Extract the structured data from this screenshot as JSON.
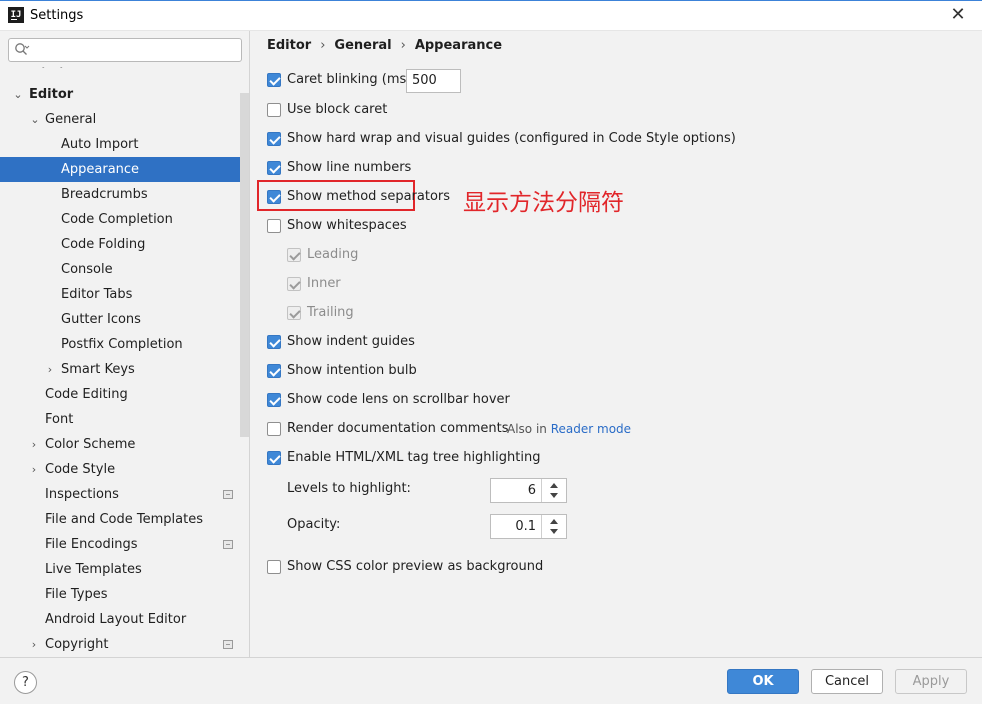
{
  "window": {
    "title": "Settings",
    "app_icon": "IJ"
  },
  "search": {
    "placeholder": "",
    "value": ""
  },
  "sidebar": {
    "items": [
      {
        "label": "Editor",
        "bold": true,
        "arrow": "expanded"
      },
      {
        "label": "General",
        "arrow": "expanded"
      },
      {
        "label": "Auto Import"
      },
      {
        "label": "Appearance",
        "selected": true
      },
      {
        "label": "Breadcrumbs"
      },
      {
        "label": "Code Completion"
      },
      {
        "label": "Code Folding"
      },
      {
        "label": "Console"
      },
      {
        "label": "Editor Tabs"
      },
      {
        "label": "Gutter Icons"
      },
      {
        "label": "Postfix Completion"
      },
      {
        "label": "Smart Keys",
        "arrow": "collapsed"
      },
      {
        "label": "Code Editing"
      },
      {
        "label": "Font"
      },
      {
        "label": "Color Scheme",
        "arrow": "collapsed"
      },
      {
        "label": "Code Style",
        "arrow": "collapsed"
      },
      {
        "label": "Inspections",
        "project_icon": true
      },
      {
        "label": "File and Code Templates"
      },
      {
        "label": "File Encodings",
        "project_icon": true
      },
      {
        "label": "Live Templates"
      },
      {
        "label": "File Types"
      },
      {
        "label": "Android Layout Editor"
      },
      {
        "label": "Copyright",
        "arrow": "collapsed",
        "project_icon": true
      }
    ]
  },
  "breadcrumb": [
    "Editor",
    "General",
    "Appearance"
  ],
  "settings": {
    "caret_blinking": {
      "label": "Caret blinking (ms):",
      "checked": true,
      "value": "500"
    },
    "use_block_caret": {
      "label": "Use block caret",
      "checked": false
    },
    "hard_wrap": {
      "label": "Show hard wrap and visual guides (configured in Code Style options)",
      "checked": true
    },
    "line_numbers": {
      "label": "Show line numbers",
      "checked": true
    },
    "method_separators": {
      "label": "Show method separators",
      "checked": true
    },
    "whitespaces": {
      "label": "Show whitespaces",
      "checked": false
    },
    "leading": {
      "label": "Leading",
      "checked": true,
      "disabled": true
    },
    "inner": {
      "label": "Inner",
      "checked": true,
      "disabled": true
    },
    "trailing": {
      "label": "Trailing",
      "checked": true,
      "disabled": true
    },
    "indent_guides": {
      "label": "Show indent guides",
      "checked": true
    },
    "intention_bulb": {
      "label": "Show intention bulb",
      "checked": true
    },
    "code_lens": {
      "label": "Show code lens on scrollbar hover",
      "checked": true
    },
    "render_docs": {
      "label": "Render documentation comments",
      "checked": false,
      "also_in": "Also in",
      "also_in_link": "Reader mode"
    },
    "tag_tree": {
      "label": "Enable HTML/XML tag tree highlighting",
      "checked": true
    },
    "levels": {
      "label": "Levels to highlight:",
      "value": "6"
    },
    "opacity": {
      "label": "Opacity:",
      "value": "0.1"
    },
    "css_preview": {
      "label": "Show CSS color preview as background",
      "checked": false
    }
  },
  "annotation": {
    "text": "显示方法分隔符",
    "color": "#e1262a"
  },
  "footer": {
    "help": "?",
    "ok": "OK",
    "cancel": "Cancel",
    "apply": "Apply"
  },
  "colors": {
    "accent": "#2f71c4",
    "checkbox": "#3f88d7",
    "link": "#2a6cc7"
  }
}
